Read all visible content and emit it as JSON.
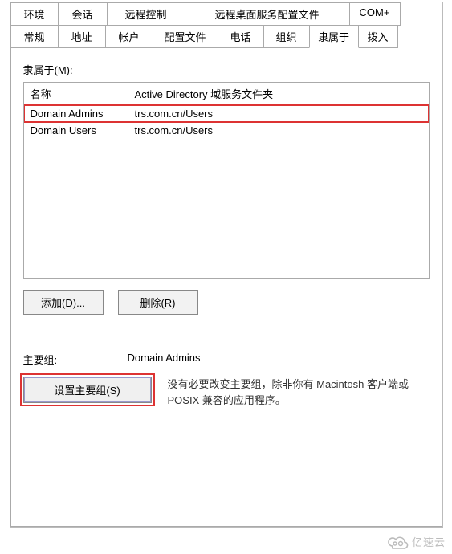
{
  "tabs_row1": [
    "环境",
    "会话",
    "远程控制",
    "远程桌面服务配置文件",
    "COM+"
  ],
  "tabs_row2": [
    "常规",
    "地址",
    "帐户",
    "配置文件",
    "电话",
    "组织",
    "隶属于",
    "拨入"
  ],
  "active_tab": "隶属于",
  "memberof": {
    "label": "隶属于(M):",
    "columns": {
      "name": "名称",
      "folder": "Active Directory 域服务文件夹"
    },
    "rows": [
      {
        "name": "Domain Admins",
        "folder": "trs.com.cn/Users",
        "highlighted": true
      },
      {
        "name": "Domain Users",
        "folder": "trs.com.cn/Users",
        "highlighted": false
      }
    ]
  },
  "buttons": {
    "add": "添加(D)...",
    "remove": "删除(R)"
  },
  "primary": {
    "label": "主要组:",
    "value": "Domain Admins",
    "set_button": "设置主要组(S)",
    "hint": "没有必要改变主要组，除非你有 Macintosh 客户端或 POSIX 兼容的应用程序。"
  },
  "watermark": {
    "text": "亿速云"
  }
}
